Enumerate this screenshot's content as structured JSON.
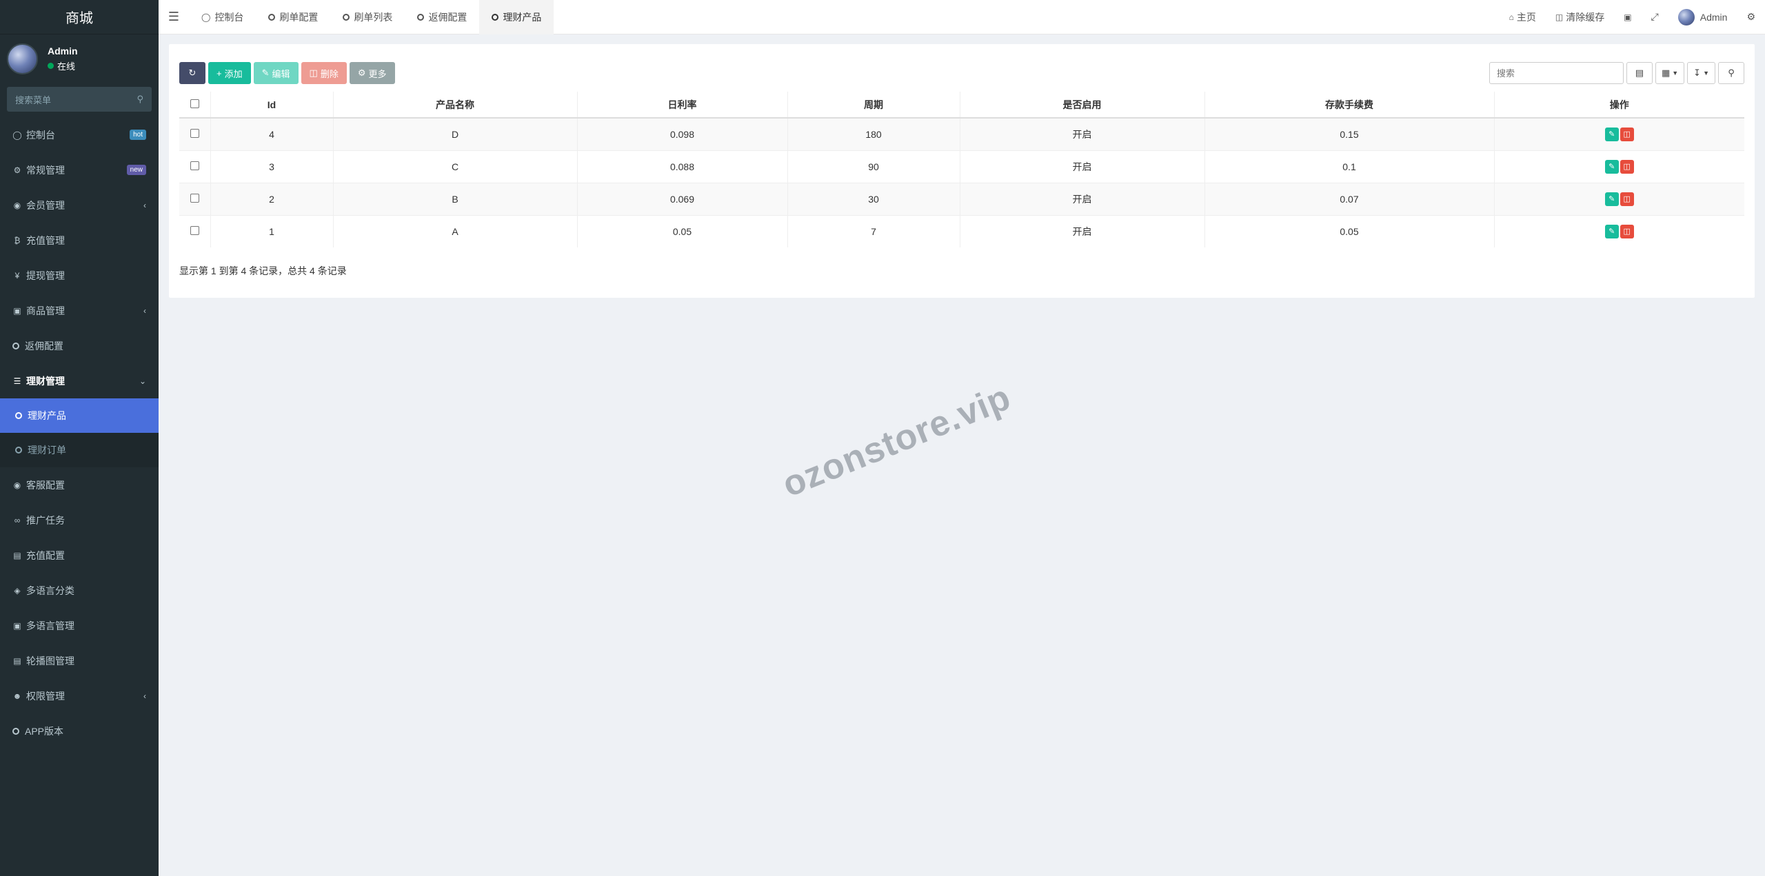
{
  "sidebar": {
    "logo": "商城",
    "user": {
      "name": "Admin",
      "status": "在线"
    },
    "search_placeholder": "搜索菜单",
    "items": [
      {
        "label": "控制台",
        "badge": "hot"
      },
      {
        "label": "常规管理",
        "badge": "new"
      },
      {
        "label": "会员管理"
      },
      {
        "label": "充值管理"
      },
      {
        "label": "提现管理"
      },
      {
        "label": "商品管理"
      },
      {
        "label": "返佣配置"
      },
      {
        "label": "理财管理"
      },
      {
        "label": "理财产品"
      },
      {
        "label": "理财订单"
      },
      {
        "label": "客服配置"
      },
      {
        "label": "推广任务"
      },
      {
        "label": "充值配置"
      },
      {
        "label": "多语言分类"
      },
      {
        "label": "多语言管理"
      },
      {
        "label": "轮播图管理"
      },
      {
        "label": "权限管理"
      },
      {
        "label": "APP版本"
      }
    ]
  },
  "topbar": {
    "tabs": [
      "控制台",
      "刷单配置",
      "刷单列表",
      "返佣配置",
      "理财产品"
    ],
    "right": {
      "home": "主页",
      "clear_cache": "清除缓存",
      "user": "Admin"
    }
  },
  "toolbar": {
    "add": "添加",
    "edit": "编辑",
    "delete": "删除",
    "more": "更多",
    "search_placeholder": "搜索"
  },
  "table": {
    "headers": [
      "Id",
      "产品名称",
      "日利率",
      "周期",
      "是否启用",
      "存款手续费",
      "操作"
    ],
    "rows": [
      {
        "id": "4",
        "name": "D",
        "rate": "0.098",
        "period": "180",
        "enabled": "开启",
        "fee": "0.15"
      },
      {
        "id": "3",
        "name": "C",
        "rate": "0.088",
        "period": "90",
        "enabled": "开启",
        "fee": "0.1"
      },
      {
        "id": "2",
        "name": "B",
        "rate": "0.069",
        "period": "30",
        "enabled": "开启",
        "fee": "0.07"
      },
      {
        "id": "1",
        "name": "A",
        "rate": "0.05",
        "period": "7",
        "enabled": "开启",
        "fee": "0.05"
      }
    ],
    "summary": "显示第 1 到第 4 条记录，总共 4 条记录"
  },
  "watermark": "ozonstore.vip",
  "colors": {
    "sidebar_bg": "#222d32",
    "active_item": "#4a6fdc",
    "accent_green": "#18bc9c",
    "danger": "#e74c3c"
  }
}
